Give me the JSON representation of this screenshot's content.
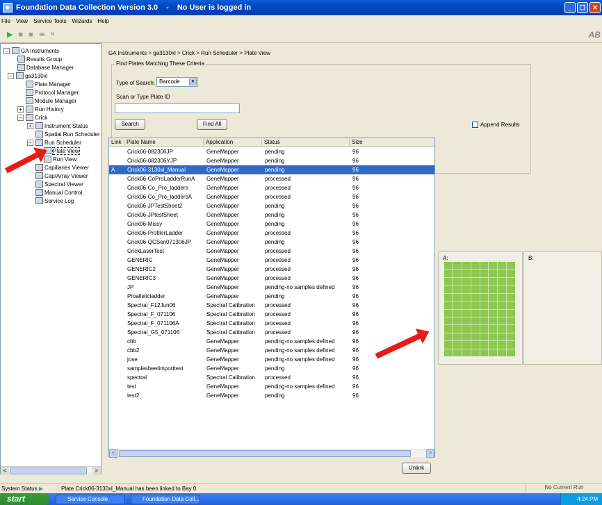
{
  "window": {
    "title": "Foundation Data Collection Version 3.0",
    "separator": "-",
    "login_status": "No User is logged in",
    "min_glyph": "_",
    "max_glyph": "❐",
    "close_glyph": "✕"
  },
  "menu": [
    "File",
    "View",
    "Service Tools",
    "Wizards",
    "Help"
  ],
  "toolbar": {
    "play_glyph": "▶",
    "stop_glyph": "■",
    "stop2_glyph": "■",
    "skip_glyph": "⇼",
    "pause_glyph": "⏸",
    "logo_text": "AB"
  },
  "tree": {
    "root": "GA Instruments",
    "results_group": "Results Group",
    "database_manager": "Database Manager",
    "instrument": "ga3130xl",
    "plate_manager": "Plate Manager",
    "protocol_manager": "Protocol Manager",
    "module_manager": "Module Manager",
    "run_history": "Run History",
    "crick": "Crick",
    "instrument_status": "Instrument Status",
    "spatial_run_scheduler": "Spatial Run Scheduler",
    "run_scheduler": "Run Scheduler",
    "plate_view": "Plate View",
    "run_view": "Run View",
    "capillaries_viewer": "Capillaries Viewer",
    "cap_array_viewer": "Cap/Array Viewer",
    "spectral_viewer": "Spectral Viewer",
    "manual_control": "Manual Control",
    "service_log": "Service Log",
    "expand_plus": "+",
    "expand_minus": "−"
  },
  "breadcrumb": "GA Instruments > ga3130xl > Crick > Run Scheduler > Plate View",
  "criteria": {
    "legend": "Find Plates Matching These Criteria",
    "type_label": "Type of Search:",
    "type_value": "Barcode",
    "scan_label": "Scan or Type Plate ID",
    "plate_id_value": "",
    "search_button": "Search",
    "find_all_button": "Find All",
    "append_label": "Append Results",
    "append_checked": false
  },
  "table": {
    "columns": [
      "Link",
      "Plate Name",
      "Application",
      "Status",
      "Size"
    ],
    "rows": [
      {
        "link": "",
        "name": "Crick06-082306JP",
        "app": "GeneMapper",
        "status": "pending",
        "size": "96"
      },
      {
        "link": "",
        "name": "Crick06-082306YJP",
        "app": "GeneMapper",
        "status": "pending",
        "size": "96"
      },
      {
        "link": "A",
        "name": "Crick06-3130xl_Manual",
        "app": "GeneMapper",
        "status": "pending",
        "size": "96",
        "selected": true
      },
      {
        "link": "",
        "name": "Crick06-CoProLadderRunA",
        "app": "GeneMapper",
        "status": "processed",
        "size": "96"
      },
      {
        "link": "",
        "name": "Crick06-Co_Pro_ladders",
        "app": "GeneMapper",
        "status": "processed",
        "size": "96"
      },
      {
        "link": "",
        "name": "Crick06-Co_Pro_laddersA",
        "app": "GeneMapper",
        "status": "processed",
        "size": "96"
      },
      {
        "link": "",
        "name": "Crick06-JPTestSheet2",
        "app": "GeneMapper",
        "status": "pending",
        "size": "96"
      },
      {
        "link": "",
        "name": "Crick06-JPtestSheet",
        "app": "GeneMapper",
        "status": "pending",
        "size": "96"
      },
      {
        "link": "",
        "name": "Crick06-Missy",
        "app": "GeneMapper",
        "status": "pending",
        "size": "96"
      },
      {
        "link": "",
        "name": "Crick06-ProfilerLadder",
        "app": "GeneMapper",
        "status": "processed",
        "size": "96"
      },
      {
        "link": "",
        "name": "Crick06-QCSen071306JP",
        "app": "GeneMapper",
        "status": "pending",
        "size": "96"
      },
      {
        "link": "",
        "name": "CrickLaserTest",
        "app": "GeneMapper",
        "status": "processed",
        "size": "96"
      },
      {
        "link": "",
        "name": "GENERIC",
        "app": "GeneMapper",
        "status": "processed",
        "size": "96"
      },
      {
        "link": "",
        "name": "GENERIC2",
        "app": "GeneMapper",
        "status": "processed",
        "size": "96"
      },
      {
        "link": "",
        "name": "GENERIC3",
        "app": "GeneMapper",
        "status": "processed",
        "size": "96"
      },
      {
        "link": "",
        "name": "JP",
        "app": "GeneMapper",
        "status": "pending-no samples defined",
        "size": "96"
      },
      {
        "link": "",
        "name": "Proallelicladder",
        "app": "GeneMapper",
        "status": "pending",
        "size": "96"
      },
      {
        "link": "",
        "name": "Spectral_F12Jun06",
        "app": "Spectral Calibration",
        "status": "processed",
        "size": "96"
      },
      {
        "link": "",
        "name": "Spectral_F_071106",
        "app": "Spectral Calibration",
        "status": "processed",
        "size": "96"
      },
      {
        "link": "",
        "name": "Spectral_F_071106A",
        "app": "Spectral Calibration",
        "status": "processed",
        "size": "96"
      },
      {
        "link": "",
        "name": "Spectral_G5_071106",
        "app": "Spectral Calibration",
        "status": "processed",
        "size": "96"
      },
      {
        "link": "",
        "name": "cbb",
        "app": "GeneMapper",
        "status": "pending-no samples defined",
        "size": "96"
      },
      {
        "link": "",
        "name": "cbb2",
        "app": "GeneMapper",
        "status": "pending-no samples defined",
        "size": "96"
      },
      {
        "link": "",
        "name": "jose",
        "app": "GeneMapper",
        "status": "pending-no samples defined",
        "size": "96"
      },
      {
        "link": "",
        "name": "samplesheetimporttest",
        "app": "GeneMapper",
        "status": "pending",
        "size": "96"
      },
      {
        "link": "",
        "name": "spectral",
        "app": "Spectral Calibration",
        "status": "processed",
        "size": "96"
      },
      {
        "link": "",
        "name": "test",
        "app": "GeneMapper",
        "status": "pending-no samples defined",
        "size": "96"
      },
      {
        "link": "",
        "name": "test2",
        "app": "GeneMapper",
        "status": "pending",
        "size": "96"
      }
    ],
    "scroll_left": "<",
    "scroll_right": ">"
  },
  "unlink_button": "Unlink",
  "plates": {
    "a_label": "A:",
    "b_label": "B:",
    "well_color": "#8cc751",
    "well_rows": 12,
    "well_cols": 8
  },
  "status": {
    "label": "System Status",
    "message": "Plate Crick06-3130xl_Manual has been linked to Bay 0",
    "run_status": "No Current Run"
  },
  "taskbar": {
    "start": "start",
    "task1": "Service Console",
    "task2": "Foundation Data Coll...",
    "clock": "4:24 PM"
  },
  "colors": {
    "title_blue": "#0346c0",
    "selection_blue": "#316ac5",
    "well_green": "#8cc751",
    "annotation_red": "#e81a1a"
  }
}
